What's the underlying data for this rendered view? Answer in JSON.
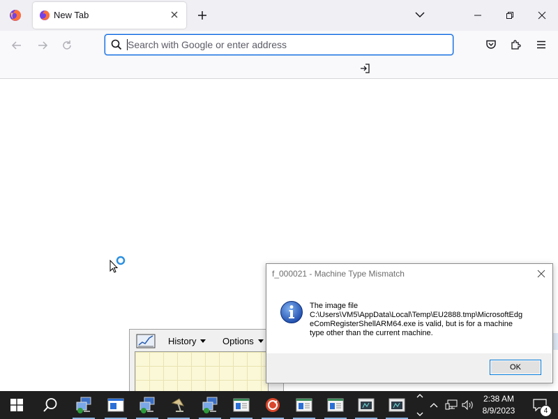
{
  "browser": {
    "tab": {
      "title": "New Tab"
    },
    "urlbar": {
      "placeholder": "Search with Google or enter address"
    }
  },
  "background_app": {
    "menus": [
      {
        "label": "History"
      },
      {
        "label": "Options"
      }
    ]
  },
  "dialog": {
    "title": "f_000021 - Machine Type Mismatch",
    "message_lines": [
      "The image file",
      "C:\\Users\\VM5\\AppData\\Local\\Temp\\EU2888.tmp\\MicrosoftEdg",
      "eComRegisterShellARM64.exe is valid, but is for a machine",
      "type other than the current machine."
    ],
    "ok_label": "OK"
  },
  "taskbar": {
    "time": "2:38 AM",
    "date": "8/9/2023",
    "notification_count": "4"
  },
  "colors": {
    "accent": "#0061e0",
    "taskbar": "#1f1f1f",
    "tabstrip": "#f0f0f4",
    "dialog_button_border": "#0078d7"
  }
}
